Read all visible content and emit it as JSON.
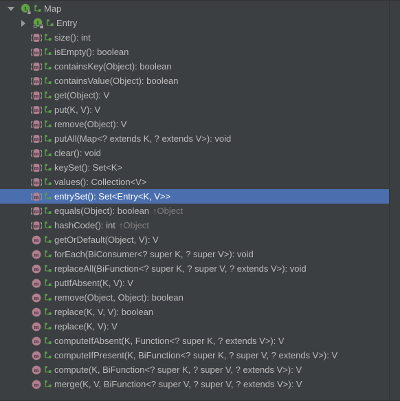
{
  "panel": {
    "name": "structure-tree",
    "background": "#3c3f41",
    "selection_color": "#4b6eaf",
    "text_color": "#bbbbbb",
    "dim_text_color": "#808080",
    "interface_icon_color": "#62a246",
    "method_icon_color": "#b07f8e",
    "lock_icon_color": "#a0a0a0",
    "brace_icon_color": "#5a9e4b"
  },
  "rows": [
    {
      "label": "Map",
      "icon": "interface-icon",
      "modifier_icon": "lock-icon",
      "secondary_icon": "inherited-member-icon",
      "indent": "lvl0",
      "toggle": "expanded",
      "selected": false,
      "trailing": ""
    },
    {
      "label": "Entry",
      "icon": "interface-static-icon",
      "modifier_icon": "lock-icon",
      "secondary_icon": "inherited-member-icon",
      "indent": "lvl1",
      "toggle": "collapsed",
      "selected": false,
      "trailing": ""
    },
    {
      "label": "size(): int",
      "icon": "abstract-method-icon",
      "secondary_icon": "inherited-member-icon",
      "indent": "lvl2",
      "toggle": "none",
      "selected": false,
      "trailing": ""
    },
    {
      "label": "isEmpty(): boolean",
      "icon": "abstract-method-icon",
      "secondary_icon": "inherited-member-icon",
      "indent": "lvl2",
      "toggle": "none",
      "selected": false,
      "trailing": ""
    },
    {
      "label": "containsKey(Object): boolean",
      "icon": "abstract-method-icon",
      "secondary_icon": "inherited-member-icon",
      "indent": "lvl2",
      "toggle": "none",
      "selected": false,
      "trailing": ""
    },
    {
      "label": "containsValue(Object): boolean",
      "icon": "abstract-method-icon",
      "secondary_icon": "inherited-member-icon",
      "indent": "lvl2",
      "toggle": "none",
      "selected": false,
      "trailing": ""
    },
    {
      "label": "get(Object): V",
      "icon": "abstract-method-icon",
      "secondary_icon": "inherited-member-icon",
      "indent": "lvl2",
      "toggle": "none",
      "selected": false,
      "trailing": ""
    },
    {
      "label": "put(K, V): V",
      "icon": "abstract-method-icon",
      "secondary_icon": "inherited-member-icon",
      "indent": "lvl2",
      "toggle": "none",
      "selected": false,
      "trailing": ""
    },
    {
      "label": "remove(Object): V",
      "icon": "abstract-method-icon",
      "secondary_icon": "inherited-member-icon",
      "indent": "lvl2",
      "toggle": "none",
      "selected": false,
      "trailing": ""
    },
    {
      "label": "putAll(Map<? extends K, ? extends V>): void",
      "icon": "abstract-method-icon",
      "secondary_icon": "inherited-member-icon",
      "indent": "lvl2",
      "toggle": "none",
      "selected": false,
      "trailing": ""
    },
    {
      "label": "clear(): void",
      "icon": "abstract-method-icon",
      "secondary_icon": "inherited-member-icon",
      "indent": "lvl2",
      "toggle": "none",
      "selected": false,
      "trailing": ""
    },
    {
      "label": "keySet(): Set<K>",
      "icon": "abstract-method-icon",
      "secondary_icon": "inherited-member-icon",
      "indent": "lvl2",
      "toggle": "none",
      "selected": false,
      "trailing": ""
    },
    {
      "label": "values(): Collection<V>",
      "icon": "abstract-method-icon",
      "secondary_icon": "inherited-member-icon",
      "indent": "lvl2",
      "toggle": "none",
      "selected": false,
      "trailing": ""
    },
    {
      "label": "entrySet(): Set<Entry<K, V>>",
      "icon": "abstract-method-icon",
      "secondary_icon": "inherited-member-icon",
      "indent": "lvl2",
      "toggle": "none",
      "selected": true,
      "trailing": ""
    },
    {
      "label": "equals(Object): boolean",
      "icon": "abstract-method-icon",
      "secondary_icon": "inherited-member-icon",
      "indent": "lvl2",
      "toggle": "none",
      "selected": false,
      "trailing": "↑Object"
    },
    {
      "label": "hashCode(): int",
      "icon": "abstract-method-icon",
      "secondary_icon": "inherited-member-icon",
      "indent": "lvl2",
      "toggle": "none",
      "selected": false,
      "trailing": "↑Object"
    },
    {
      "label": "getOrDefault(Object, V): V",
      "icon": "method-icon",
      "secondary_icon": "inherited-member-icon",
      "indent": "lvl2",
      "toggle": "none",
      "selected": false,
      "trailing": ""
    },
    {
      "label": "forEach(BiConsumer<? super K, ? super V>): void",
      "icon": "method-icon",
      "secondary_icon": "inherited-member-icon",
      "indent": "lvl2",
      "toggle": "none",
      "selected": false,
      "trailing": ""
    },
    {
      "label": "replaceAll(BiFunction<? super K, ? super V, ? extends V>): void",
      "icon": "method-icon",
      "secondary_icon": "inherited-member-icon",
      "indent": "lvl2",
      "toggle": "none",
      "selected": false,
      "trailing": ""
    },
    {
      "label": "putIfAbsent(K, V): V",
      "icon": "method-icon",
      "secondary_icon": "inherited-member-icon",
      "indent": "lvl2",
      "toggle": "none",
      "selected": false,
      "trailing": ""
    },
    {
      "label": "remove(Object, Object): boolean",
      "icon": "method-icon",
      "secondary_icon": "inherited-member-icon",
      "indent": "lvl2",
      "toggle": "none",
      "selected": false,
      "trailing": ""
    },
    {
      "label": "replace(K, V, V): boolean",
      "icon": "method-icon",
      "secondary_icon": "inherited-member-icon",
      "indent": "lvl2",
      "toggle": "none",
      "selected": false,
      "trailing": ""
    },
    {
      "label": "replace(K, V): V",
      "icon": "method-icon",
      "secondary_icon": "inherited-member-icon",
      "indent": "lvl2",
      "toggle": "none",
      "selected": false,
      "trailing": ""
    },
    {
      "label": "computeIfAbsent(K, Function<? super K, ? extends V>): V",
      "icon": "method-icon",
      "secondary_icon": "inherited-member-icon",
      "indent": "lvl2",
      "toggle": "none",
      "selected": false,
      "trailing": ""
    },
    {
      "label": "computeIfPresent(K, BiFunction<? super K, ? super V, ? extends V>): V",
      "icon": "method-icon",
      "secondary_icon": "inherited-member-icon",
      "indent": "lvl2",
      "toggle": "none",
      "selected": false,
      "trailing": ""
    },
    {
      "label": "compute(K, BiFunction<? super K, ? super V, ? extends V>): V",
      "icon": "method-icon",
      "secondary_icon": "inherited-member-icon",
      "indent": "lvl2",
      "toggle": "none",
      "selected": false,
      "trailing": ""
    },
    {
      "label": "merge(K, V, BiFunction<? super V, ? super V, ? extends V>): V",
      "icon": "method-icon",
      "secondary_icon": "inherited-member-icon",
      "indent": "lvl2",
      "toggle": "none",
      "selected": false,
      "trailing": ""
    }
  ]
}
